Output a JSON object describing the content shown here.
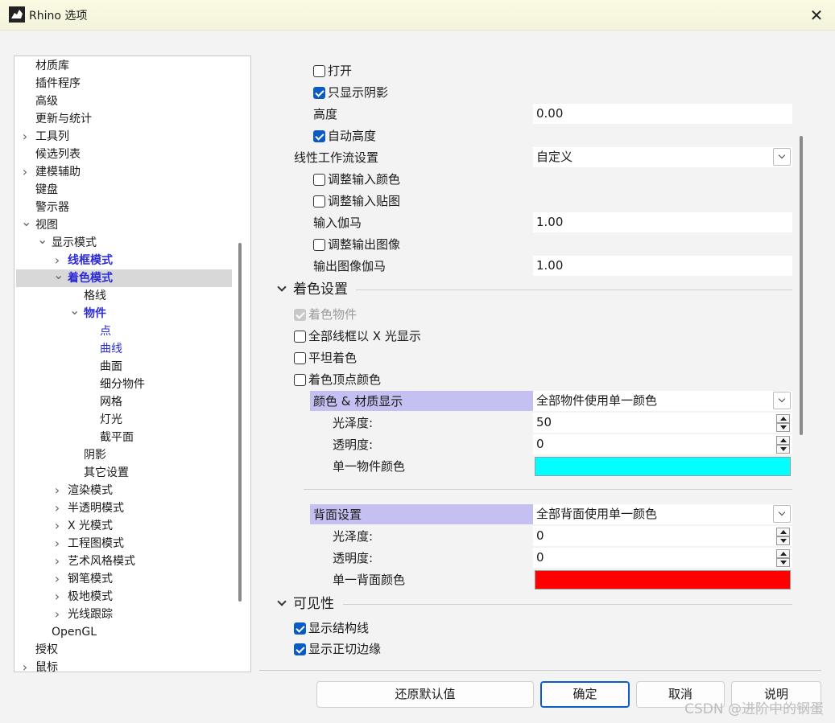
{
  "window": {
    "title": "Rhino 选项",
    "close_glyph": "✕",
    "app_icon": "rhino-icon"
  },
  "tree": {
    "items": [
      {
        "label": "材质库",
        "indent": 0,
        "chevron": ""
      },
      {
        "label": "插件程序",
        "indent": 0,
        "chevron": ""
      },
      {
        "label": "高级",
        "indent": 0,
        "chevron": ""
      },
      {
        "label": "更新与统计",
        "indent": 0,
        "chevron": ""
      },
      {
        "label": "工具列",
        "indent": 0,
        "chevron": "right"
      },
      {
        "label": "候选列表",
        "indent": 0,
        "chevron": ""
      },
      {
        "label": "建模辅助",
        "indent": 0,
        "chevron": "right"
      },
      {
        "label": "键盘",
        "indent": 0,
        "chevron": ""
      },
      {
        "label": "警示器",
        "indent": 0,
        "chevron": ""
      },
      {
        "label": "视图",
        "indent": 0,
        "chevron": "down"
      },
      {
        "label": "显示模式",
        "indent": 1,
        "chevron": "down"
      },
      {
        "label": "线框模式",
        "indent": 2,
        "chevron": "right",
        "style": "bold"
      },
      {
        "label": "着色模式",
        "indent": 2,
        "chevron": "down",
        "style": "bold",
        "selected": true
      },
      {
        "label": "格线",
        "indent": 3,
        "chevron": ""
      },
      {
        "label": "物件",
        "indent": 3,
        "chevron": "down",
        "style": "bold"
      },
      {
        "label": "点",
        "indent": 4,
        "chevron": "",
        "style": "link"
      },
      {
        "label": "曲线",
        "indent": 4,
        "chevron": "",
        "style": "link"
      },
      {
        "label": "曲面",
        "indent": 4,
        "chevron": ""
      },
      {
        "label": "细分物件",
        "indent": 4,
        "chevron": ""
      },
      {
        "label": "网格",
        "indent": 4,
        "chevron": ""
      },
      {
        "label": "灯光",
        "indent": 4,
        "chevron": ""
      },
      {
        "label": "截平面",
        "indent": 4,
        "chevron": ""
      },
      {
        "label": "阴影",
        "indent": 3,
        "chevron": ""
      },
      {
        "label": "其它设置",
        "indent": 3,
        "chevron": ""
      },
      {
        "label": "渲染模式",
        "indent": 2,
        "chevron": "right"
      },
      {
        "label": "半透明模式",
        "indent": 2,
        "chevron": "right"
      },
      {
        "label": "X 光模式",
        "indent": 2,
        "chevron": "right"
      },
      {
        "label": "工程图模式",
        "indent": 2,
        "chevron": "right"
      },
      {
        "label": "艺术风格模式",
        "indent": 2,
        "chevron": "right"
      },
      {
        "label": "钢笔模式",
        "indent": 2,
        "chevron": "right"
      },
      {
        "label": "极地模式",
        "indent": 2,
        "chevron": "right"
      },
      {
        "label": "光线跟踪",
        "indent": 2,
        "chevron": "right"
      },
      {
        "label": "OpenGL",
        "indent": 1,
        "chevron": ""
      },
      {
        "label": "授权",
        "indent": 0,
        "chevron": ""
      },
      {
        "label": "鼠标",
        "indent": 0,
        "chevron": "right"
      }
    ]
  },
  "settings": {
    "open": {
      "label": "打开",
      "checked": false
    },
    "shadow_only": {
      "label": "只显示阴影",
      "checked": true
    },
    "height": {
      "label": "高度",
      "value": "0.00"
    },
    "auto_height": {
      "label": "自动高度",
      "checked": true
    },
    "linear_workflow": {
      "label": "线性工作流设置",
      "value": "自定义"
    },
    "adjust_input_color": {
      "label": "调整输入颜色",
      "checked": false
    },
    "adjust_input_texture": {
      "label": "调整输入贴图",
      "checked": false
    },
    "input_gamma": {
      "label": "输入伽马",
      "value": "1.00"
    },
    "adjust_output_image": {
      "label": "调整输出图像",
      "checked": false
    },
    "output_gamma": {
      "label": "输出图像伽马",
      "value": "1.00"
    }
  },
  "shading": {
    "header": "着色设置",
    "shade_objects": {
      "label": "着色物件",
      "checked": true,
      "disabled": true
    },
    "xray_wires": {
      "label": "全部线框以 X 光显示",
      "checked": false
    },
    "flat_shading": {
      "label": "平坦着色",
      "checked": false
    },
    "vertex_colors": {
      "label": "着色顶点颜色",
      "checked": false
    },
    "color_material": {
      "label": "颜色 & 材质显示",
      "value": "全部物件使用单一颜色"
    },
    "gloss": {
      "label": "光泽度:",
      "value": "50"
    },
    "transparency": {
      "label": "透明度:",
      "value": "0"
    },
    "single_color": {
      "label": "单一物件颜色",
      "color": "#00ffff"
    },
    "backface": {
      "label": "背面设置",
      "value": "全部背面使用单一颜色"
    },
    "back_gloss": {
      "label": "光泽度:",
      "value": "0"
    },
    "back_transparency": {
      "label": "透明度:",
      "value": "0"
    },
    "back_color": {
      "label": "单一背面颜色",
      "color": "#ff0000"
    }
  },
  "visibility": {
    "header": "可见性",
    "show_isocurves": {
      "label": "显示结构线",
      "checked": true
    },
    "show_tangent_edges": {
      "label": "显示正切边缘",
      "checked": true
    }
  },
  "buttons": {
    "restore": "还原默认值",
    "ok": "确定",
    "cancel": "取消",
    "help": "说明"
  },
  "watermark": "CSDN @进阶中的钢蛋",
  "colors": {
    "accent": "#0a5cc2",
    "band": "#c4c1f2",
    "link": "#2a2ad8"
  }
}
